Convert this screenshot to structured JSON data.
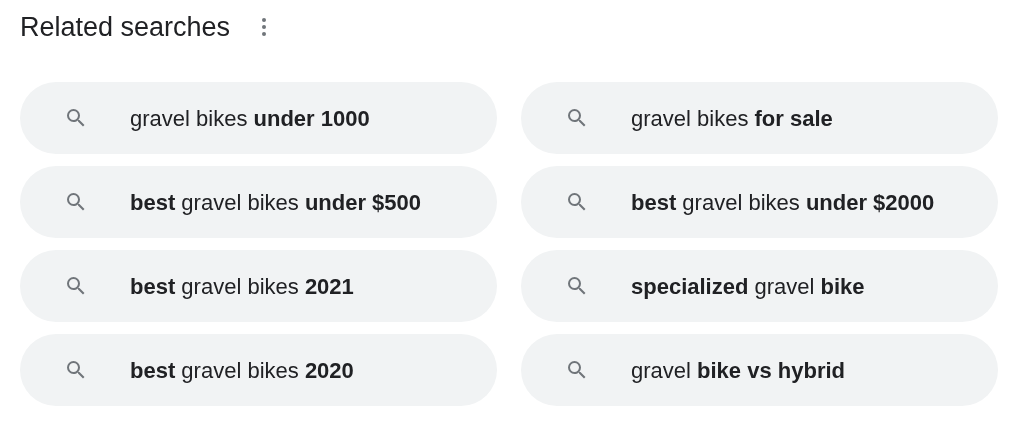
{
  "title": "Related searches",
  "suggestions": [
    {
      "text": "gravel bikes **under 1000**"
    },
    {
      "text": "gravel bikes **for sale**"
    },
    {
      "text": "**best** gravel bikes **under $500**"
    },
    {
      "text": "**best** gravel bikes **under $2000**"
    },
    {
      "text": "**best** gravel bikes **2021**"
    },
    {
      "text": "**specialized** gravel **bike**"
    },
    {
      "text": "**best** gravel bikes **2020**"
    },
    {
      "text": "gravel **bike vs hybrid**"
    }
  ]
}
